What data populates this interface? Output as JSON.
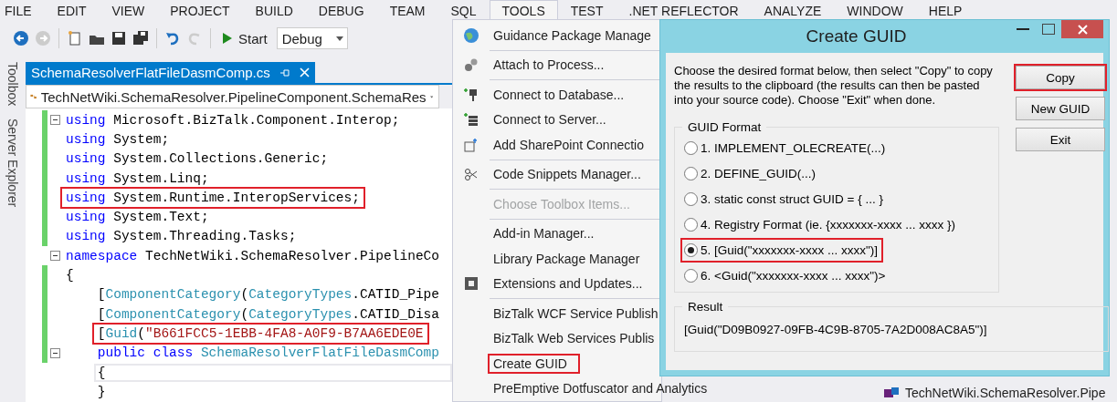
{
  "menubar": {
    "items": [
      {
        "label": "FILE",
        "selected": false
      },
      {
        "label": "EDIT",
        "selected": false
      },
      {
        "label": "VIEW",
        "selected": false
      },
      {
        "label": "PROJECT",
        "selected": false
      },
      {
        "label": "BUILD",
        "selected": false
      },
      {
        "label": "DEBUG",
        "selected": false
      },
      {
        "label": "TEAM",
        "selected": false
      },
      {
        "label": "SQL",
        "selected": false
      },
      {
        "label": "TOOLS",
        "selected": true
      },
      {
        "label": "TEST",
        "selected": false
      },
      {
        "label": ".NET REFLECTOR",
        "selected": false
      },
      {
        "label": "ANALYZE",
        "selected": false
      },
      {
        "label": "WINDOW",
        "selected": false
      },
      {
        "label": "HELP",
        "selected": false
      }
    ]
  },
  "toolbar": {
    "start_label": "Start",
    "configuration": "Debug"
  },
  "side_tabs": [
    "Toolbox",
    "Server Explorer"
  ],
  "editor": {
    "tab": {
      "title": "SchemaResolverFlatFileDasmComp.cs",
      "selected": true
    },
    "nav_path": "TechNetWiki.SchemaResolver.PipelineComponent.SchemaRes",
    "lines": [
      {
        "fold": true,
        "changed": true,
        "highlighted": false,
        "current": false,
        "tokens": [
          {
            "kind": "keyword",
            "text": "using"
          },
          {
            "kind": "plain",
            "text": " Microsoft.BizTalk.Component.Interop;"
          }
        ]
      },
      {
        "fold": false,
        "changed": true,
        "highlighted": false,
        "current": false,
        "tokens": [
          {
            "kind": "keyword",
            "text": "using"
          },
          {
            "kind": "plain",
            "text": " System;"
          }
        ]
      },
      {
        "fold": false,
        "changed": true,
        "highlighted": false,
        "current": false,
        "tokens": [
          {
            "kind": "keyword",
            "text": "using"
          },
          {
            "kind": "plain",
            "text": " System.Collections.Generic;"
          }
        ]
      },
      {
        "fold": false,
        "changed": true,
        "highlighted": false,
        "current": false,
        "tokens": [
          {
            "kind": "keyword",
            "text": "using"
          },
          {
            "kind": "plain",
            "text": " System.Linq;"
          }
        ]
      },
      {
        "fold": false,
        "changed": true,
        "highlighted": true,
        "current": false,
        "tokens": [
          {
            "kind": "keyword",
            "text": "using"
          },
          {
            "kind": "plain",
            "text": " System.Runtime.InteropServices;"
          }
        ]
      },
      {
        "fold": false,
        "changed": true,
        "highlighted": false,
        "current": false,
        "tokens": [
          {
            "kind": "keyword",
            "text": "using"
          },
          {
            "kind": "plain",
            "text": " System.Text;"
          }
        ]
      },
      {
        "fold": false,
        "changed": true,
        "highlighted": false,
        "current": false,
        "tokens": [
          {
            "kind": "keyword",
            "text": "using"
          },
          {
            "kind": "plain",
            "text": " System.Threading.Tasks;"
          }
        ]
      },
      {
        "fold": true,
        "changed": false,
        "highlighted": false,
        "current": false,
        "tokens": [
          {
            "kind": "keyword",
            "text": "namespace"
          },
          {
            "kind": "plain",
            "text": " TechNetWiki.SchemaResolver.PipelineCo"
          }
        ]
      },
      {
        "fold": false,
        "changed": true,
        "highlighted": false,
        "current": false,
        "tokens": [
          {
            "kind": "plain",
            "text": "{"
          }
        ]
      },
      {
        "fold": false,
        "changed": true,
        "highlighted": false,
        "current": false,
        "indented": true,
        "tokens": [
          {
            "kind": "plain",
            "text": "["
          },
          {
            "kind": "type",
            "text": "ComponentCategory"
          },
          {
            "kind": "plain",
            "text": "("
          },
          {
            "kind": "type",
            "text": "CategoryTypes"
          },
          {
            "kind": "plain",
            "text": ".CATID_Pipe"
          }
        ]
      },
      {
        "fold": false,
        "changed": true,
        "highlighted": false,
        "current": false,
        "indented": true,
        "tokens": [
          {
            "kind": "plain",
            "text": "["
          },
          {
            "kind": "type",
            "text": "ComponentCategory"
          },
          {
            "kind": "plain",
            "text": "("
          },
          {
            "kind": "type",
            "text": "CategoryTypes"
          },
          {
            "kind": "plain",
            "text": ".CATID_Disa"
          }
        ]
      },
      {
        "fold": false,
        "changed": true,
        "highlighted": true,
        "current": false,
        "indented": true,
        "tokens": [
          {
            "kind": "plain",
            "text": "["
          },
          {
            "kind": "type",
            "text": "Guid"
          },
          {
            "kind": "plain",
            "text": "("
          },
          {
            "kind": "string",
            "text": "\"B661FCC5-1EBB-4FA8-A0F9-B7AA6EDE0E"
          }
        ]
      },
      {
        "fold": true,
        "changed": true,
        "highlighted": false,
        "current": false,
        "indented": true,
        "tokens": [
          {
            "kind": "keyword",
            "text": "public class"
          },
          {
            "kind": "type",
            "text": " SchemaResolverFlatFileDasmComp"
          }
        ]
      },
      {
        "fold": false,
        "changed": false,
        "highlighted": false,
        "current": true,
        "indented": true,
        "tokens": [
          {
            "kind": "plain",
            "text": "{"
          }
        ]
      },
      {
        "fold": false,
        "changed": false,
        "highlighted": false,
        "current": false,
        "indented": true,
        "tokens": [
          {
            "kind": "plain",
            "text": "}"
          }
        ]
      }
    ]
  },
  "tools_menu": {
    "items": [
      {
        "label": "Guidance Package Manage",
        "disabled": false,
        "highlighted": false,
        "separator_after": true
      },
      {
        "label": "Attach to Process...",
        "disabled": false,
        "highlighted": false,
        "separator_after": true
      },
      {
        "label": "Connect to Database...",
        "disabled": false,
        "highlighted": false,
        "separator_after": false
      },
      {
        "label": "Connect to Server...",
        "disabled": false,
        "highlighted": false,
        "separator_after": false
      },
      {
        "label": "Add SharePoint Connectio",
        "disabled": false,
        "highlighted": false,
        "separator_after": true
      },
      {
        "label": "Code Snippets Manager...",
        "disabled": false,
        "highlighted": false,
        "separator_after": true
      },
      {
        "label": "Choose Toolbox Items...",
        "disabled": true,
        "highlighted": false,
        "separator_after": true
      },
      {
        "label": "Add-in Manager...",
        "disabled": false,
        "highlighted": false,
        "separator_after": false
      },
      {
        "label": "Library Package Manager",
        "disabled": false,
        "highlighted": false,
        "separator_after": false
      },
      {
        "label": "Extensions and Updates...",
        "disabled": false,
        "highlighted": false,
        "separator_after": true
      },
      {
        "label": "BizTalk WCF Service Publish",
        "disabled": false,
        "highlighted": false,
        "separator_after": false
      },
      {
        "label": "BizTalk Web Services Publis",
        "disabled": false,
        "highlighted": false,
        "separator_after": false
      },
      {
        "label": "Create GUID",
        "disabled": false,
        "highlighted": true,
        "separator_after": false
      },
      {
        "label": "PreEmptive Dotfuscator and Analytics",
        "disabled": false,
        "highlighted": false,
        "separator_after": false
      }
    ]
  },
  "dialog": {
    "title": "Create GUID",
    "description": "Choose the desired format below, then select \"Copy\" to copy the results to the clipboard (the results can then be pasted into your source code).  Choose \"Exit\" when done.",
    "buttons": [
      {
        "label": "Copy",
        "highlighted": true
      },
      {
        "label": "New GUID",
        "highlighted": false
      },
      {
        "label": "Exit",
        "highlighted": false
      }
    ],
    "format_group": {
      "title": "GUID Format",
      "options": [
        {
          "label": "1. IMPLEMENT_OLECREATE(...)",
          "selected": false,
          "highlighted": false
        },
        {
          "label": "2. DEFINE_GUID(...)",
          "selected": false,
          "highlighted": false
        },
        {
          "label": "3. static const struct GUID = { ... }",
          "selected": false,
          "highlighted": false
        },
        {
          "label": "4. Registry Format (ie. {xxxxxxx-xxxx ... xxxx })",
          "selected": false,
          "highlighted": false
        },
        {
          "label": "5. [Guid(\"xxxxxxx-xxxx ... xxxx\")]",
          "selected": true,
          "highlighted": true
        },
        {
          "label": "6. <Guid(\"xxxxxxx-xxxx ... xxxx\")>",
          "selected": false,
          "highlighted": false
        }
      ]
    },
    "result": {
      "title": "Result",
      "value": "[Guid(\"D09B0927-09FB-4C9B-8705-7A2D008AC8A5\")]"
    }
  },
  "solution_explorer": {
    "item": "TechNetWiki.SchemaResolver.Pipe"
  }
}
